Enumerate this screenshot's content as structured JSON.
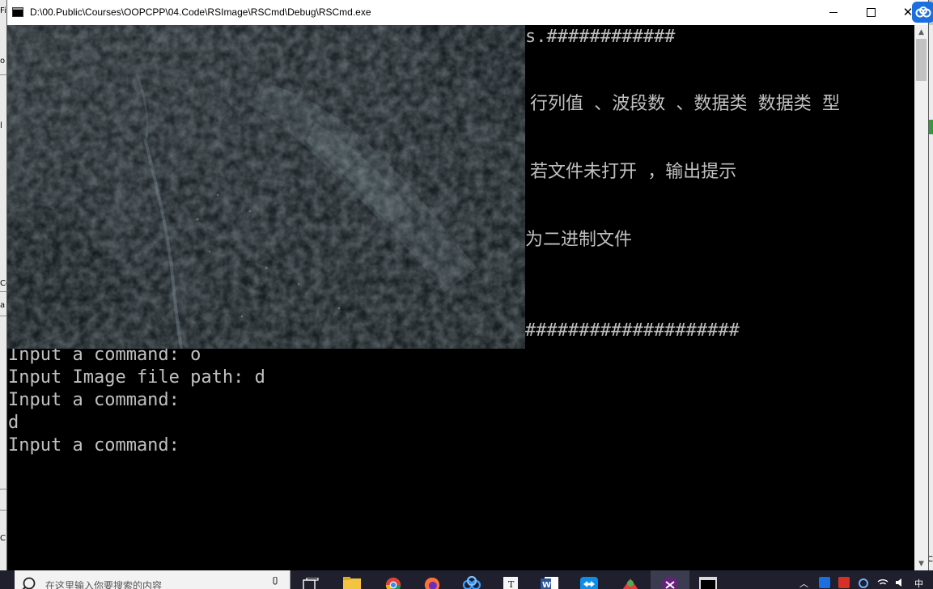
{
  "window": {
    "title": "D:\\00.Public\\Courses\\OOPCPP\\04.Code\\RSImage\\RSCmd\\Debug\\RSCmd.exe",
    "minimize_glyph": "—",
    "maximize_glyph": "☐",
    "close_glyph": "✕"
  },
  "console": {
    "partial_lines": [
      "s.############",
      "行列值 、波段数 、数据类 数据类 型",
      "若文件未打开 ，输出提示",
      "为二进制文件",
      "####################"
    ],
    "lines": [
      "Input a command: o",
      "Input Image file path: d",
      "Input a command:",
      "d",
      "Input a command:"
    ]
  },
  "taskbar": {
    "search_placeholder": "在这里输入你要搜索的内容",
    "apps": [
      "task-view-icon",
      "file-explorer-icon",
      "chrome-icon",
      "firefox-icon",
      "baidu-netdisk-icon",
      "typora-icon",
      "word-icon",
      "teamviewer-icon",
      "xmind-icon",
      "visual-studio-icon",
      "console-app-icon"
    ]
  },
  "colors": {
    "console_bg": "#000000",
    "console_fg": "#c0c0c0",
    "titlebar_bg": "#ffffff",
    "taskbar_bg": "#1f1f2e"
  }
}
